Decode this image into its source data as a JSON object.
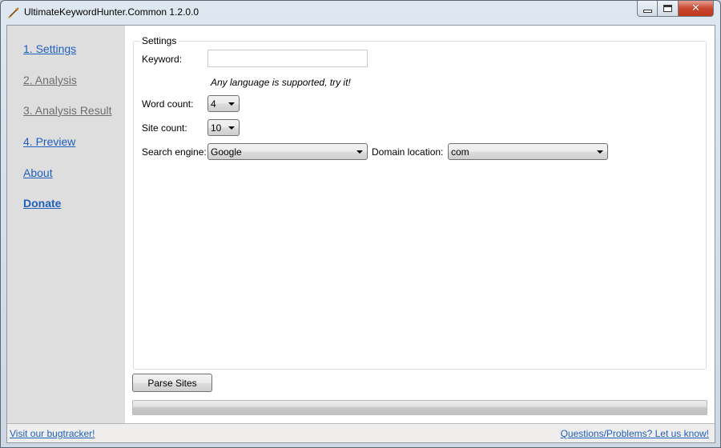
{
  "window": {
    "title": "UltimateKeywordHunter.Common 1.2.0.0",
    "icon": "pencil-arrow-icon",
    "controls": {
      "minimize": "minimize",
      "maximize": "maximize",
      "close": "✕"
    }
  },
  "sidebar": {
    "items": [
      {
        "label": "1. Settings",
        "state": "active"
      },
      {
        "label": "2. Analysis",
        "state": "disabled"
      },
      {
        "label": "3. Analysis Result",
        "state": "disabled"
      },
      {
        "label": "4. Preview",
        "state": "active"
      },
      {
        "label": "About",
        "state": "active"
      },
      {
        "label": "Donate",
        "state": "bold"
      }
    ]
  },
  "settings": {
    "group_title": "Settings",
    "keyword": {
      "label": "Keyword:",
      "value": "",
      "placeholder": ""
    },
    "hint": "Any language is supported, try it!",
    "word_count": {
      "label": "Word count:",
      "value": "4"
    },
    "site_count": {
      "label": "Site count:",
      "value": "10"
    },
    "search_engine": {
      "label": "Search engine:",
      "value": "Google"
    },
    "domain_location": {
      "label": "Domain location:",
      "value": "com"
    }
  },
  "actions": {
    "parse_label": "Parse Sites",
    "progress_percent": 0
  },
  "statusbar": {
    "left_link": "Visit our bugtracker!",
    "right_link": "Questions/Problems? Let us know!"
  },
  "colors": {
    "link": "#1f5fbf",
    "disabled_link": "#6e6e6e",
    "sidebar_bg": "#dedede"
  }
}
